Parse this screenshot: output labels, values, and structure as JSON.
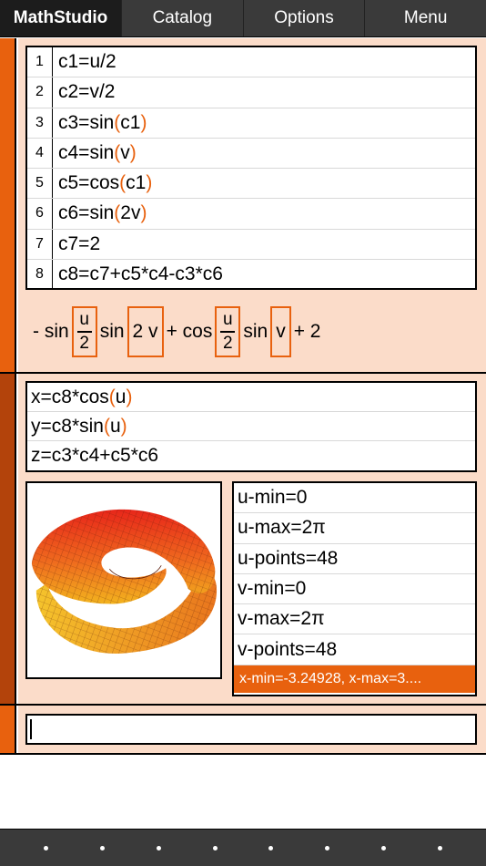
{
  "nav": {
    "tabs": [
      "MathStudio",
      "Catalog",
      "Options",
      "Menu"
    ]
  },
  "code": {
    "lines": [
      {
        "num": "1",
        "pre": "c1=u/2",
        "paren": false
      },
      {
        "num": "2",
        "pre": "c2=v/2",
        "paren": false
      },
      {
        "num": "3",
        "pre": "c3=sin",
        "arg": "c1",
        "paren": true
      },
      {
        "num": "4",
        "pre": "c4=sin",
        "arg": "v",
        "paren": true
      },
      {
        "num": "5",
        "pre": "c5=cos",
        "arg": "c1",
        "paren": true
      },
      {
        "num": "6",
        "pre": "c6=sin",
        "arg": "2v",
        "paren": true
      },
      {
        "num": "7",
        "pre": "c7=2",
        "paren": false
      },
      {
        "num": "8",
        "pre": "c8=c7+c5*c4-c3*c6",
        "paren": false
      }
    ]
  },
  "result": {
    "neg_sin": "- sin",
    "frac1_num": "u",
    "frac1_den": "2",
    "sin2": "sin",
    "arg2": "2 v",
    "plus_cos": "+ cos",
    "frac2_num": "u",
    "frac2_den": "2",
    "sin3": "sin",
    "arg3": "v",
    "plus2": "+ 2"
  },
  "equations": [
    {
      "pre": "x=c8*cos",
      "arg": "u"
    },
    {
      "pre": "y=c8*sin",
      "arg": "u"
    },
    {
      "pre": "z=c3*c4+c5*c6",
      "arg": ""
    }
  ],
  "params": [
    "u-min=0",
    "u-max=2π",
    "u-points=48",
    "v-min=0",
    "v-max=2π",
    "v-points=48"
  ],
  "status": "x-min=-3.24928, x-max=3....",
  "input": {
    "value": ""
  },
  "colors": {
    "accent": "#e8610e",
    "gutter_dark": "#b3430b",
    "panel": "#fbdcc9",
    "bar": "#3a3a3a"
  },
  "bottom_dots": 8
}
